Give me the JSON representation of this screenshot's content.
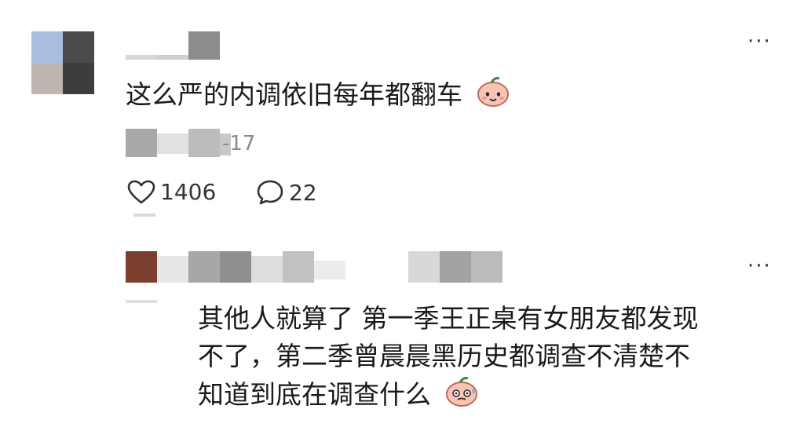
{
  "comment": {
    "text": "这么严的内调依旧每年都翻车",
    "emoji": "peach-smile-icon",
    "date_suffix": "-17",
    "likes": "1406",
    "replies": "22",
    "more": "···"
  },
  "reply": {
    "lines": [
      "其他人就算了 第一季王正桌有女朋友都发现",
      "不了，第二季曾晨晨黑历史都调查不清楚不",
      "知道到底在调查什么"
    ],
    "emoji": "peach-sweat-icon",
    "more": "···"
  },
  "colors": {
    "text": "#1a1a1a",
    "meta": "#8a8a8a",
    "blur_gray": "#9a9a9a",
    "avatar_brown": "#7a3f2e"
  }
}
